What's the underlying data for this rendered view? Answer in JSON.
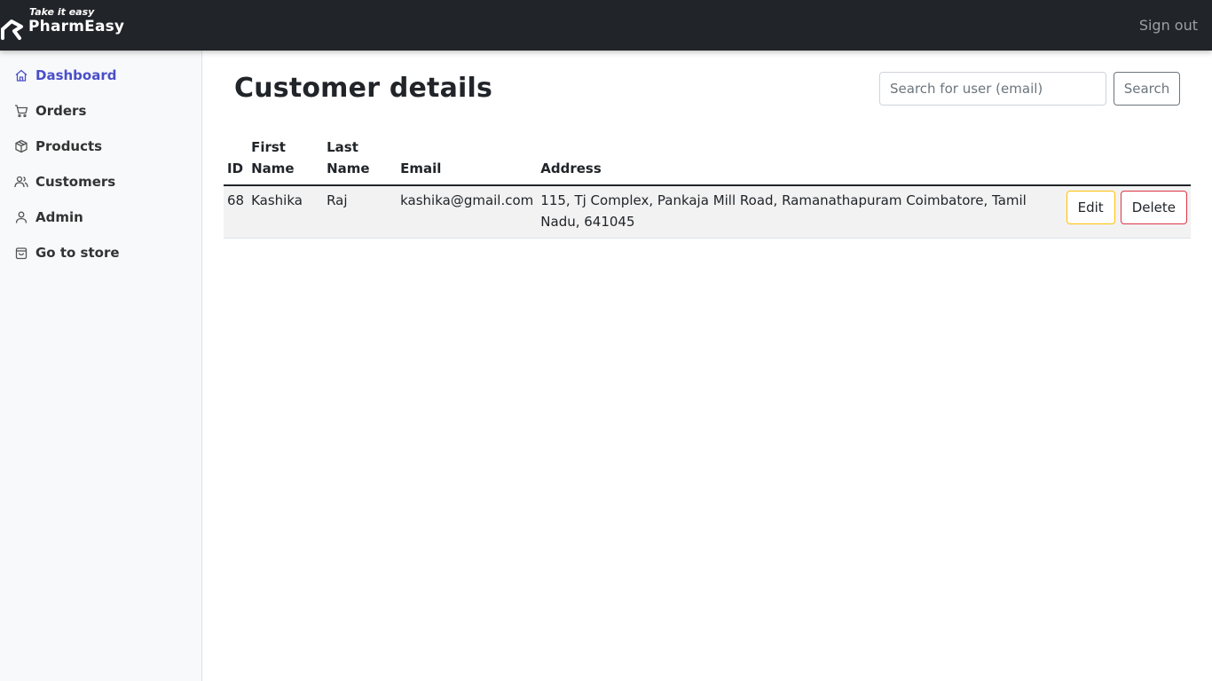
{
  "header": {
    "tagline": "Take it easy",
    "brand": "PharmEasy",
    "signout_label": "Sign out"
  },
  "sidebar": {
    "items": [
      {
        "label": "Dashboard",
        "icon": "home-icon",
        "active": true
      },
      {
        "label": "Orders",
        "icon": "cart-icon"
      },
      {
        "label": "Products",
        "icon": "box-icon"
      },
      {
        "label": "Customers",
        "icon": "users-icon"
      },
      {
        "label": "Admin",
        "icon": "user-icon"
      },
      {
        "label": "Go to store",
        "icon": "shopping-bag-icon"
      }
    ]
  },
  "main": {
    "title": "Customer details",
    "search": {
      "placeholder": "Search for user (email)",
      "value": "",
      "button_label": "Search"
    },
    "table": {
      "columns": {
        "id": "ID",
        "first_name": "First Name",
        "last_name": "Last Name",
        "email": "Email",
        "address": "Address"
      },
      "rows": [
        {
          "id": "68",
          "first_name": "Kashika",
          "last_name": "Raj",
          "email": "kashika@gmail.com",
          "address": "115, Tj Complex, Pankaja Mill Road, Ramanathapuram Coimbatore, Tamil Nadu, 641045",
          "edit_label": "Edit",
          "delete_label": "Delete"
        }
      ]
    }
  },
  "colors": {
    "navbar": "#212529",
    "sidebar": "#f8f9fa",
    "active_link": "#4a4fc9",
    "edit_border": "#ffc107",
    "delete_border": "#dc3545"
  }
}
